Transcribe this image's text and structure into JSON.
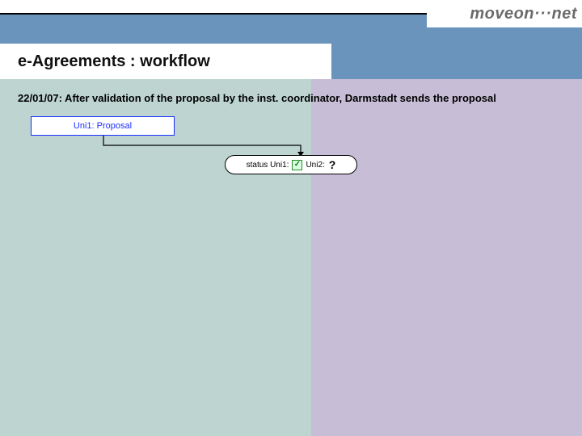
{
  "brand": {
    "logo_text": "moveon···net"
  },
  "header": {
    "title": "e-Agreements : workflow"
  },
  "caption": "22/01/07: After validation of the proposal by the inst. coordinator, Darmstadt sends the proposal",
  "diagram": {
    "proposal_box": {
      "label": "Uni1: Proposal"
    },
    "status": {
      "uni1_label": "status Uni1:",
      "uni1_value_icon": "check",
      "uni2_label": "Uni2:",
      "uni2_value": "?"
    }
  },
  "colors": {
    "header_blue": "#6a94bb",
    "left_pane": "#bdd4d0",
    "right_pane": "#c7bdd6",
    "box_border": "#1a2fff"
  }
}
